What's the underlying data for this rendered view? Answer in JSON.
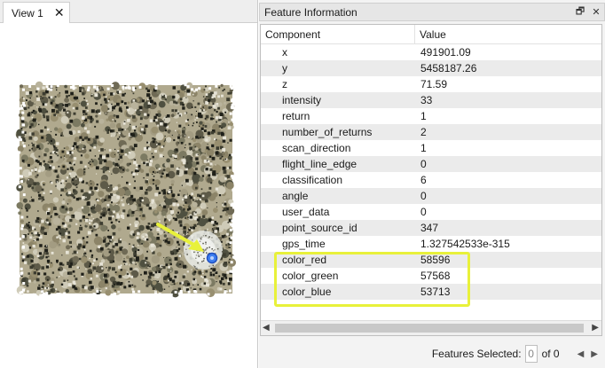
{
  "view": {
    "tab_label": "View 1",
    "close_glyph": "✕"
  },
  "info_panel": {
    "title": "Feature Information",
    "restore_glyph": "🗗",
    "close_glyph": "✕",
    "columns": {
      "component": "Component",
      "value": "Value"
    },
    "rows": [
      {
        "name": "x",
        "value": "491901.09"
      },
      {
        "name": "y",
        "value": "5458187.26"
      },
      {
        "name": "z",
        "value": "71.59"
      },
      {
        "name": "intensity",
        "value": "33"
      },
      {
        "name": "return",
        "value": "1"
      },
      {
        "name": "number_of_returns",
        "value": "2"
      },
      {
        "name": "scan_direction",
        "value": "1"
      },
      {
        "name": "flight_line_edge",
        "value": "0"
      },
      {
        "name": "classification",
        "value": "6"
      },
      {
        "name": "angle",
        "value": "0"
      },
      {
        "name": "user_data",
        "value": "0"
      },
      {
        "name": "point_source_id",
        "value": "347"
      },
      {
        "name": "gps_time",
        "value": "1.327542533e-315"
      },
      {
        "name": "color_red",
        "value": "58596"
      },
      {
        "name": "color_green",
        "value": "57568"
      },
      {
        "name": "color_blue",
        "value": "53713"
      }
    ]
  },
  "status": {
    "label": "Features Selected:",
    "current": "0",
    "of_total": "of 0"
  },
  "colors": {
    "highlight": "#e8f13a",
    "marker": "#2b6fe8",
    "arrow": "#e8f13a"
  }
}
